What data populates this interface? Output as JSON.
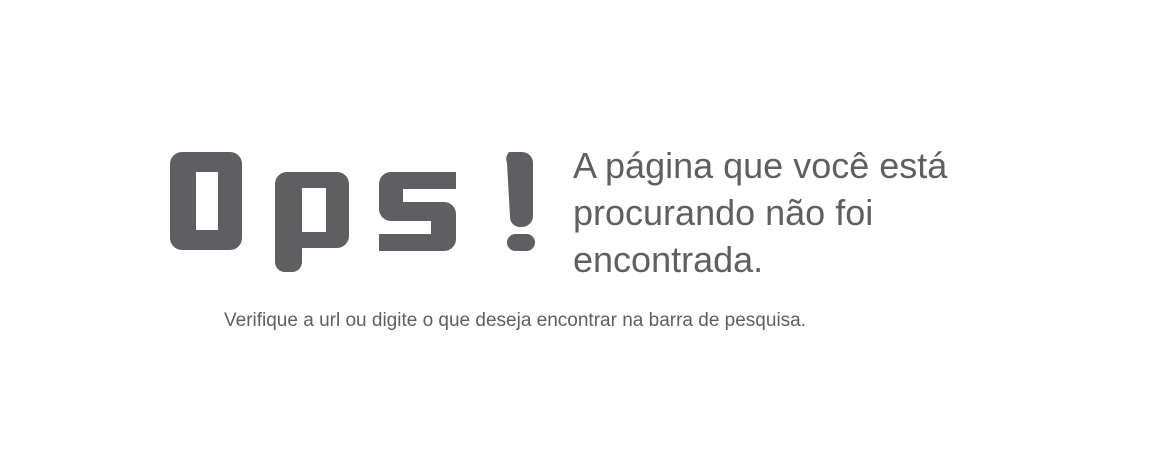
{
  "error_page": {
    "logo_text": "Ops!",
    "headline_lines": [
      "A página que você está",
      "procurando não foi",
      "encontrada."
    ],
    "subtext": "Verifique a url ou digite o que deseja encontrar na barra de pesquisa."
  },
  "colors": {
    "text": "#5f5f61",
    "background": "#ffffff"
  }
}
